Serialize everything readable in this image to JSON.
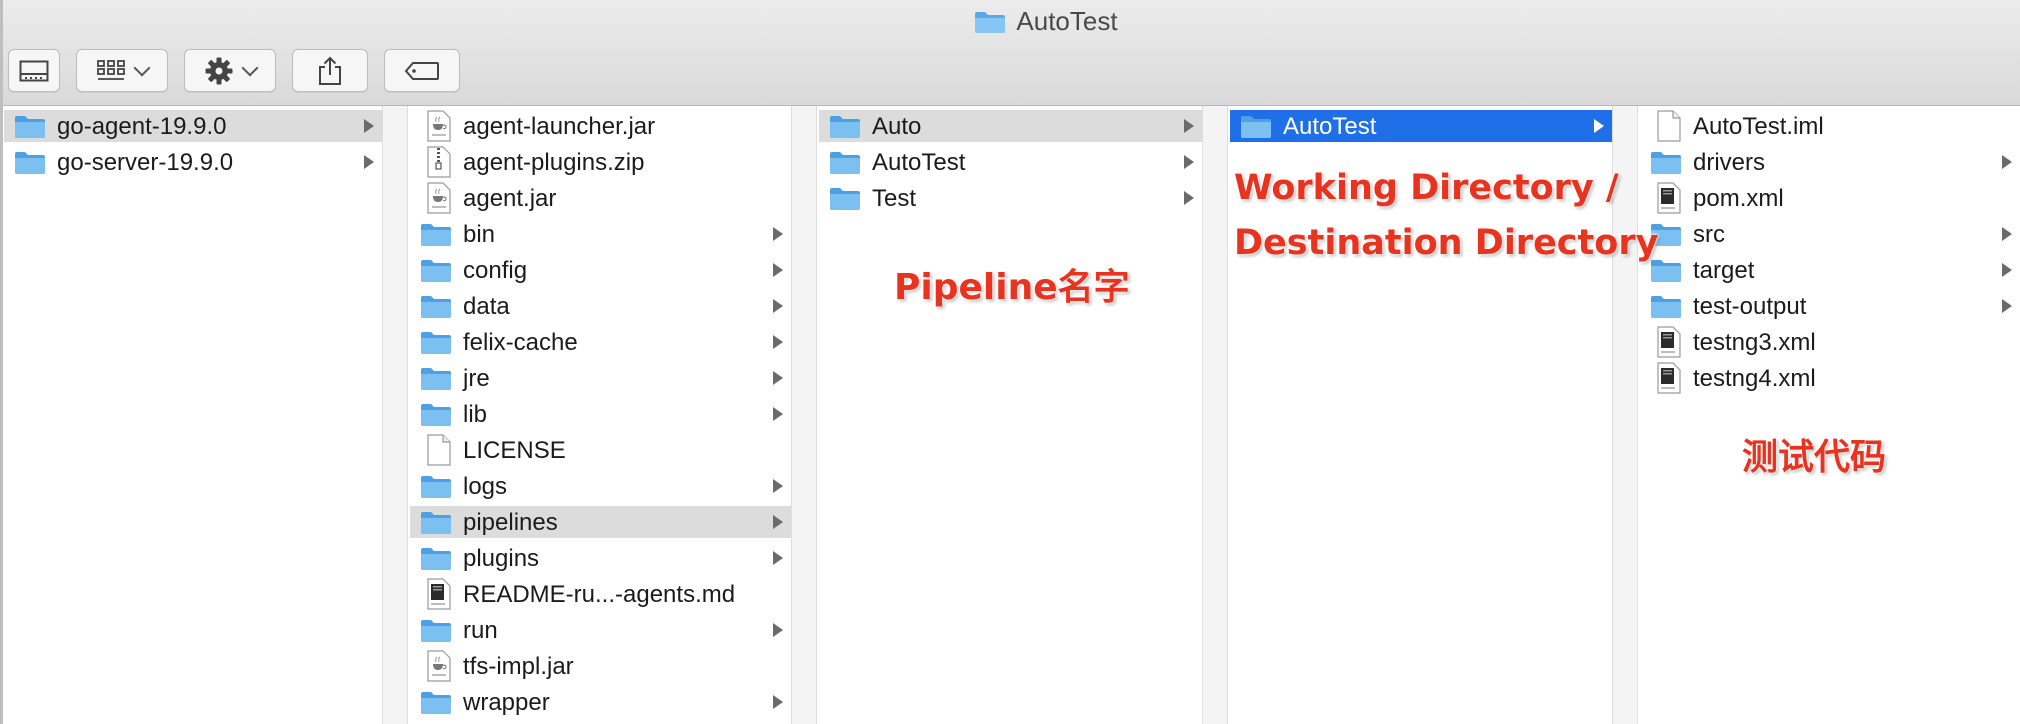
{
  "window": {
    "title": "AutoTest"
  },
  "toolbar": {
    "buttons": [
      {
        "name": "view-button",
        "icon": "column-view-icon"
      },
      {
        "name": "group-button",
        "icon": "grid-view-icon"
      },
      {
        "name": "action-button",
        "icon": "gear-icon"
      },
      {
        "name": "share-button",
        "icon": "share-icon"
      },
      {
        "name": "tag-button",
        "icon": "tag-icon"
      }
    ]
  },
  "colors": {
    "selected_blue": "#1f6fe8",
    "folder_blue": "#6bb7f0",
    "annotation_red": "#e8331f",
    "row_gray": "#dcdcdc"
  },
  "columns": [
    {
      "items": [
        {
          "label": "go-agent-19.9.0",
          "type": "folder",
          "arrow": true,
          "state": "gray"
        },
        {
          "label": "go-server-19.9.0",
          "type": "folder",
          "arrow": true,
          "state": ""
        }
      ]
    },
    {
      "items": [
        {
          "label": "agent-launcher.jar",
          "type": "jar",
          "arrow": false,
          "state": ""
        },
        {
          "label": "agent-plugins.zip",
          "type": "zip",
          "arrow": false,
          "state": ""
        },
        {
          "label": "agent.jar",
          "type": "jar",
          "arrow": false,
          "state": ""
        },
        {
          "label": "bin",
          "type": "folder",
          "arrow": true,
          "state": ""
        },
        {
          "label": "config",
          "type": "folder",
          "arrow": true,
          "state": ""
        },
        {
          "label": "data",
          "type": "folder",
          "arrow": true,
          "state": ""
        },
        {
          "label": "felix-cache",
          "type": "folder",
          "arrow": true,
          "state": ""
        },
        {
          "label": "jre",
          "type": "folder",
          "arrow": true,
          "state": ""
        },
        {
          "label": "lib",
          "type": "folder",
          "arrow": true,
          "state": ""
        },
        {
          "label": "LICENSE",
          "type": "blank",
          "arrow": false,
          "state": ""
        },
        {
          "label": "logs",
          "type": "folder",
          "arrow": true,
          "state": ""
        },
        {
          "label": "pipelines",
          "type": "folder",
          "arrow": true,
          "state": "gray"
        },
        {
          "label": "plugins",
          "type": "folder",
          "arrow": true,
          "state": ""
        },
        {
          "label": "README-ru...-agents.md",
          "type": "doc",
          "arrow": false,
          "state": ""
        },
        {
          "label": "run",
          "type": "folder",
          "arrow": true,
          "state": ""
        },
        {
          "label": "tfs-impl.jar",
          "type": "jar",
          "arrow": false,
          "state": ""
        },
        {
          "label": "wrapper",
          "type": "folder",
          "arrow": true,
          "state": ""
        }
      ]
    },
    {
      "items": [
        {
          "label": "Auto",
          "type": "folder",
          "arrow": true,
          "state": "gray"
        },
        {
          "label": "AutoTest",
          "type": "folder",
          "arrow": true,
          "state": ""
        },
        {
          "label": "Test",
          "type": "folder",
          "arrow": true,
          "state": ""
        }
      ]
    },
    {
      "items": [
        {
          "label": "AutoTest",
          "type": "folder",
          "arrow": true,
          "state": "blue"
        }
      ]
    },
    {
      "items": [
        {
          "label": "AutoTest.iml",
          "type": "blank",
          "arrow": false,
          "state": ""
        },
        {
          "label": "drivers",
          "type": "folder",
          "arrow": true,
          "state": ""
        },
        {
          "label": "pom.xml",
          "type": "doc",
          "arrow": false,
          "state": ""
        },
        {
          "label": "src",
          "type": "folder",
          "arrow": true,
          "state": ""
        },
        {
          "label": "target",
          "type": "folder",
          "arrow": true,
          "state": ""
        },
        {
          "label": "test-output",
          "type": "folder",
          "arrow": true,
          "state": ""
        },
        {
          "label": "testng3.xml",
          "type": "doc",
          "arrow": false,
          "state": ""
        },
        {
          "label": "testng4.xml",
          "type": "doc",
          "arrow": false,
          "state": ""
        }
      ]
    }
  ],
  "annotations": {
    "pipeline_name": "Pipeline名字",
    "working_dir_line1": "Working Directory /",
    "working_dir_line2": "Destination Directory",
    "test_code": "测试代码"
  }
}
